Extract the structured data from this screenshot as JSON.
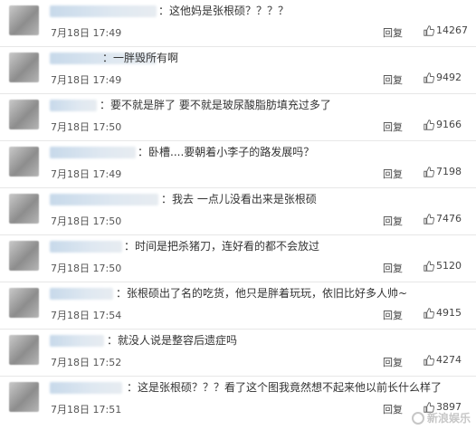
{
  "comments": [
    {
      "text": "：这他妈是张根硕？？？？",
      "time": "7月18日 17:49",
      "reply": "回复",
      "likes": "14267"
    },
    {
      "text": "：一胖毁所有啊",
      "time": "7月18日 17:49",
      "reply": "回复",
      "likes": "9492"
    },
    {
      "text": "：要不就是胖了 要不就是玻尿酸脂肪填充过多了",
      "time": "7月18日 17:50",
      "reply": "回复",
      "likes": "9166"
    },
    {
      "text": "：卧槽....要朝着小李子的路发展吗？",
      "time": "7月18日 17:49",
      "reply": "回复",
      "likes": "7198"
    },
    {
      "text": "：我去 一点儿没看出来是张根硕",
      "time": "7月18日 17:50",
      "reply": "回复",
      "likes": "7476"
    },
    {
      "text": "：时间是把杀猪刀，连好看的都不会放过",
      "time": "7月18日 17:50",
      "reply": "回复",
      "likes": "5120"
    },
    {
      "text": "：张根硕出了名的吃货，他只是胖着玩玩，依旧比好多人帅~",
      "time": "7月18日 17:54",
      "reply": "回复",
      "likes": "4915"
    },
    {
      "text": "：就没人说是整容后遗症吗",
      "time": "7月18日 17:52",
      "reply": "回复",
      "likes": "4274"
    },
    {
      "text": "：这是张根硕？？？看了这个图我竟然想不起来他以前长什么样了",
      "time": "7月18日 17:51",
      "reply": "回复",
      "likes": "3897"
    }
  ],
  "watermark": "新浪娱乐",
  "icons": {
    "like": "thumbs-up-icon"
  }
}
